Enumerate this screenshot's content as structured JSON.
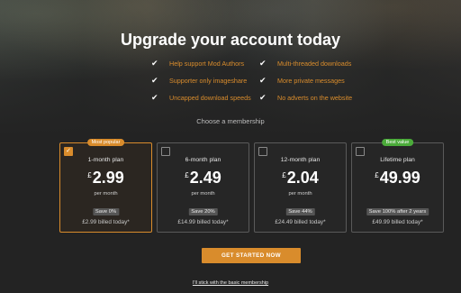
{
  "header": {
    "title": "Upgrade your account today"
  },
  "features": [
    "Help support Mod Authors",
    "Multi-threaded downloads",
    "Supporter only imageshare",
    "More private messages",
    "Uncapped download speeds",
    "No adverts on the website"
  ],
  "choose_label": "Choose a membership",
  "plans": [
    {
      "ribbon": "Most popular",
      "name": "1-month plan",
      "currency": "£",
      "price": "2.99",
      "per": "per month",
      "save": "Save 0%",
      "billed": "£2.99 billed today*",
      "selected": true
    },
    {
      "ribbon": "",
      "name": "6-month plan",
      "currency": "£",
      "price": "2.49",
      "per": "per month",
      "save": "Save 20%",
      "billed": "£14.99 billed today*",
      "selected": false
    },
    {
      "ribbon": "",
      "name": "12-month plan",
      "currency": "£",
      "price": "2.04",
      "per": "per month",
      "save": "Save 44%",
      "billed": "£24.49 billed today*",
      "selected": false
    },
    {
      "ribbon": "Best value",
      "name": "Lifetime plan",
      "currency": "£",
      "price": "49.99",
      "per": "",
      "save": "Save 100% after 2 years",
      "billed": "£49.99 billed today*",
      "selected": false
    }
  ],
  "cta_label": "GET STARTED NOW",
  "basic_link": "I'll stick with the basic membership",
  "colors": {
    "accent": "#d98c2c",
    "best_value": "#4bab3a"
  }
}
